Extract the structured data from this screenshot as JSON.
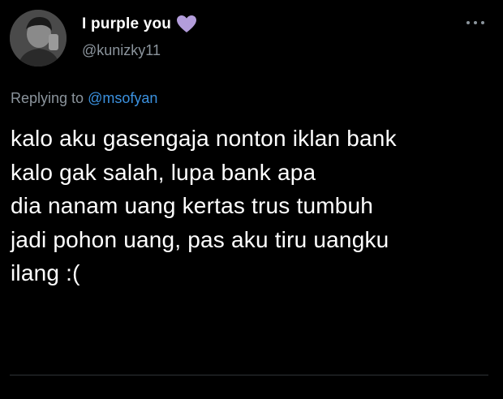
{
  "author": {
    "display_name": "I purple you",
    "handle": "@kunizky11",
    "name_emoji_icon": "purple-heart-icon"
  },
  "reply": {
    "prefix": "Replying to",
    "mention": "@msofyan"
  },
  "tweet": {
    "text": "kalo aku gasengaja nonton iklan bank\nkalo gak salah, lupa bank apa\ndia nanam uang kertas trus tumbuh\njadi pohon uang, pas aku tiru uangku\nilang :("
  },
  "colors": {
    "background": "#000000",
    "text": "#ffffff",
    "secondary_text": "#8b949c",
    "link": "#3b91df",
    "heart": "#b39ddb"
  },
  "icons": {
    "more": "more-dots-icon",
    "avatar": "avatar"
  }
}
